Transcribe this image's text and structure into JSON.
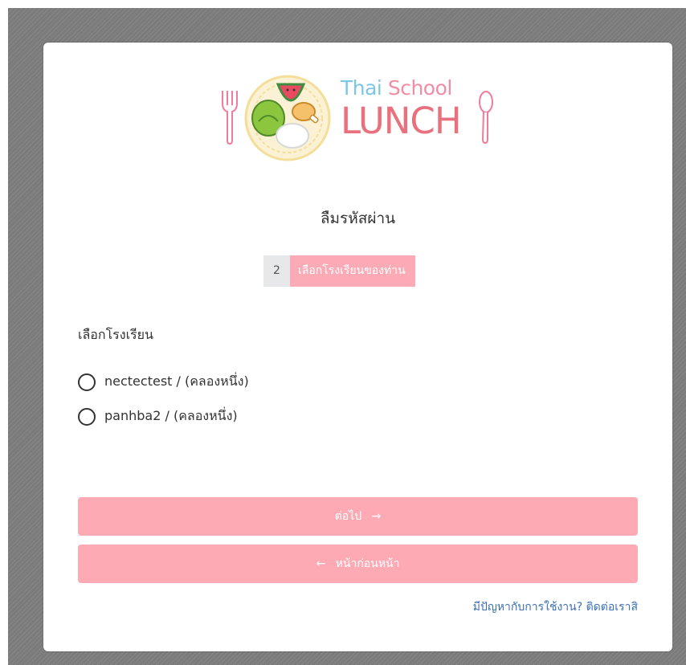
{
  "logo": {
    "line1_a": "Thai",
    "line1_b": "School",
    "line2": "LUNCH"
  },
  "page": {
    "title": "ลืมรหัสผ่าน"
  },
  "step": {
    "number": "2",
    "label": "เลือกโรงเรียนของท่าน"
  },
  "form": {
    "school_label": "เลือกโรงเรียน",
    "options": [
      {
        "label": "nectectest / (คลองหนึ่ง)",
        "selected": false
      },
      {
        "label": "panhba2 / (คลองหนึ่ง)",
        "selected": false
      }
    ]
  },
  "buttons": {
    "next": "ต่อไป",
    "next_icon": "arrow-right-icon",
    "back": "หน้าก่อนหน้า",
    "back_icon": "arrow-left-icon"
  },
  "help": {
    "link": "มีปัญหากับการใช้งาน? ติดต่อเราสิ"
  },
  "colors": {
    "accent": "#fdaab5",
    "step_bg": "#fbaab6",
    "link": "#3b6fb6",
    "backdrop": "#7b7b7b"
  }
}
